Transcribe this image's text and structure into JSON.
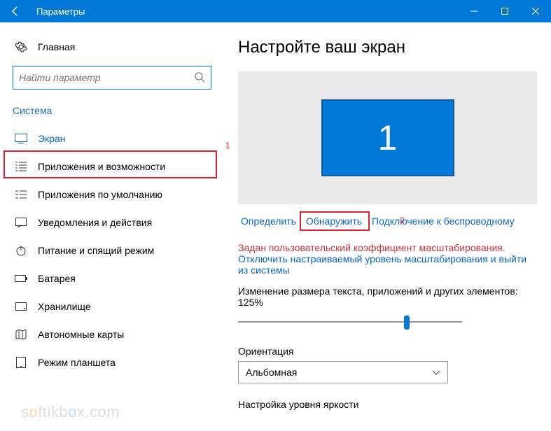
{
  "titlebar": {
    "title": "Параметры"
  },
  "sidebar": {
    "home_label": "Главная",
    "search_placeholder": "Найти параметр",
    "section_label": "Система",
    "items": [
      {
        "label": "Экран"
      },
      {
        "label": "Приложения и возможности"
      },
      {
        "label": "Приложения по умолчанию"
      },
      {
        "label": "Уведомления и действия"
      },
      {
        "label": "Питание и спящий режим"
      },
      {
        "label": "Батарея"
      },
      {
        "label": "Хранилище"
      },
      {
        "label": "Автономные карты"
      },
      {
        "label": "Режим планшета"
      }
    ]
  },
  "main": {
    "heading": "Настройте ваш экран",
    "monitor_number": "1",
    "links": {
      "identify": "Определить",
      "detect": "Обнаружить",
      "wireless": "Подключение к беспроводному"
    },
    "scaling_warning": "Задан пользовательский коэффициент масштабирования.",
    "scaling_action": "Отключить настраиваемый уровень масштабирования и выйти из системы",
    "scale_label": "Изменение размера текста, приложений и других элементов: 125%",
    "orientation_label": "Ориентация",
    "orientation_value": "Альбомная",
    "brightness_label": "Настройка уровня яркости"
  },
  "annotations": {
    "mark1": "1",
    "mark2": "2"
  },
  "watermark": "softikbox.com"
}
